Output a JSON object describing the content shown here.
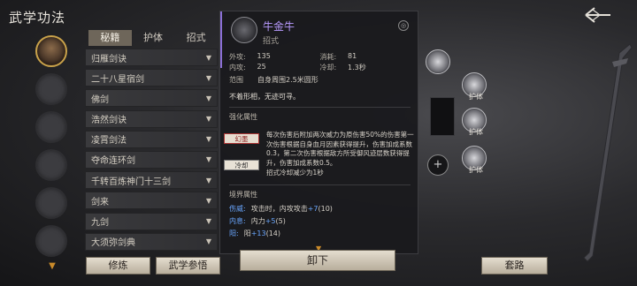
{
  "header": {
    "title": "武学功法"
  },
  "tabs": [
    {
      "label": "秘籍",
      "active": true
    },
    {
      "label": "护体",
      "active": false
    },
    {
      "label": "招式",
      "active": false
    }
  ],
  "skills": [
    "归雁剑诀",
    "二十八星宿剑",
    "佛剑",
    "浩然剑诀",
    "凌霄剑法",
    "夺命连环剑",
    "千转百炼神门十三剑",
    "剑来",
    "九剑",
    "大须弥剑典"
  ],
  "detail": {
    "name": "牛金牛",
    "type": "招式",
    "stats": {
      "outer_attack_label": "外攻:",
      "outer_attack": "135",
      "mp_cost_label": "消耗:",
      "mp_cost": "81",
      "inner_attack_label": "内攻:",
      "inner_attack": "25",
      "cooldown_label": "冷却:",
      "cooldown": "1.3秒",
      "range_label": "范围",
      "range": "自身周围2.5米圆形"
    },
    "description": "不着形相，无迹可寻。",
    "enhance_title": "强化属性",
    "enhance_tag_1": "幻墨",
    "enhance_tag_2": "冷却",
    "enhance_text": "每次伤害后附加两次威力为原伤害50%的伤害第一次伤害根据自身血月因素获得提升，伤害加成系数0.3，第二次伤害根据敌方所受御风迹层数获得提升，伤害加成系数0.5。",
    "enhance_text_2": "招式冷却减少为1秒",
    "realm_title": "境界属性",
    "realm": [
      {
        "label": "伤威:",
        "text": "攻击时，内攻攻击",
        "plus": "+7",
        "tail": "(10)"
      },
      {
        "label": "内息:",
        "text": "内力",
        "plus": "+5",
        "tail": "(5)"
      },
      {
        "label": "阳:",
        "text": "阳",
        "plus": "+13",
        "tail": "(14)"
      }
    ]
  },
  "right_panel": {
    "labels": [
      "护体",
      "护体",
      "护体"
    ]
  },
  "buttons": {
    "train": "修炼",
    "compare": "武学参悟",
    "unload": "卸下",
    "route": "套路"
  },
  "colors": {
    "accent": "#8b6fd6",
    "name": "#b99bff",
    "plus": "#6aa7ff",
    "tab_active": "#6e665a"
  }
}
